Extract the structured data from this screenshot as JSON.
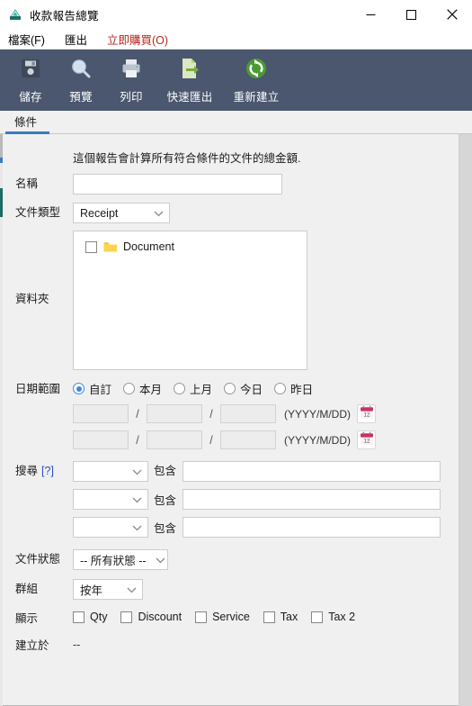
{
  "window": {
    "title": "收款報告總覽",
    "app_icon": "scanner-icon",
    "minimize_label": "—",
    "maximize_label": "☐",
    "close_label": "✕"
  },
  "menubar": {
    "items": [
      {
        "label": "檔案(F)",
        "name": "menu-file",
        "accent": false
      },
      {
        "label": "匯出",
        "name": "menu-export",
        "accent": false
      },
      {
        "label": "立即購買(O)",
        "name": "menu-buy-now",
        "accent": true
      }
    ],
    "accent_color": "#b4261a"
  },
  "toolbar": {
    "background": "#4a576e",
    "items": [
      {
        "label": "儲存",
        "icon": "floppy-disk-icon",
        "name": "toolbar-save"
      },
      {
        "label": "預覽",
        "icon": "magnifier-icon",
        "name": "toolbar-preview"
      },
      {
        "label": "列印",
        "icon": "printer-icon",
        "name": "toolbar-print"
      },
      {
        "label": "快速匯出",
        "icon": "export-file-icon",
        "name": "toolbar-quick-export"
      },
      {
        "label": "重新建立",
        "icon": "refresh-icon",
        "name": "toolbar-rebuild"
      }
    ]
  },
  "tabs": [
    {
      "label": "條件",
      "active": true,
      "name": "tab-conditions"
    }
  ],
  "form": {
    "intro": "這個報告會計算所有符合條件的文件的總金額.",
    "name": {
      "label": "名稱",
      "value": "",
      "placeholder": ""
    },
    "doc_type": {
      "label": "文件類型",
      "value": "Receipt"
    },
    "folders": {
      "label": "資料夾",
      "items": [
        {
          "label": "Document",
          "checked": false,
          "icon": "folder-icon"
        }
      ]
    },
    "date_range": {
      "label": "日期範圍",
      "options": [
        {
          "label": "自訂",
          "selected": true
        },
        {
          "label": "本月",
          "selected": false
        },
        {
          "label": "上月",
          "selected": false
        },
        {
          "label": "今日",
          "selected": false
        },
        {
          "label": "昨日",
          "selected": false
        }
      ],
      "format_hint": "(YYYY/M/DD)",
      "separator": "/",
      "calendar_icon": "calendar-icon",
      "rows": [
        {
          "year": "",
          "month": "",
          "day": ""
        },
        {
          "year": "",
          "month": "",
          "day": ""
        }
      ]
    },
    "search": {
      "label": "搜尋",
      "help": "[?]",
      "operator_label": "包含",
      "rows": [
        {
          "field": "",
          "value": ""
        },
        {
          "field": "",
          "value": ""
        },
        {
          "field": "",
          "value": ""
        }
      ]
    },
    "doc_status": {
      "label": "文件狀態",
      "value": "-- 所有狀態 --"
    },
    "group": {
      "label": "群組",
      "value": "按年"
    },
    "display": {
      "label": "顯示",
      "options": [
        {
          "label": "Qty",
          "checked": false
        },
        {
          "label": "Discount",
          "checked": false
        },
        {
          "label": "Service",
          "checked": false
        },
        {
          "label": "Tax",
          "checked": false
        },
        {
          "label": "Tax 2",
          "checked": false
        }
      ]
    },
    "created_on": {
      "label": "建立於",
      "value": "--"
    }
  }
}
